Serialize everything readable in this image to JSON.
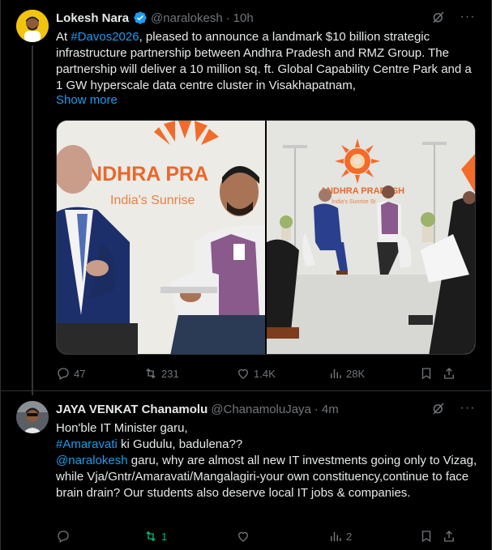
{
  "tweet1": {
    "author_name": "Lokesh Nara",
    "handle": "@naralokesh",
    "separator": "·",
    "time": "10h",
    "text_parts": {
      "pre": "At ",
      "hashtag": "#Davos2026",
      "post": ", pleased to announce a landmark $10 billion strategic infrastructure partnership between Andhra Pradesh and RMZ Group. The partnership will deliver a 10 million sq. ft. Global Capability Centre Park and a 1 GW hyperscale data centre cluster in Visakhapatnam,"
    },
    "show_more": "Show more",
    "media": {
      "left_banner_title": "ANDHRA PRA",
      "left_banner_sub": "India's Sunrise",
      "right_banner_title": "ANDHRA PRADESH",
      "right_banner_sub": "India's Sunrise St"
    },
    "actions": {
      "replies": "47",
      "reposts": "231",
      "likes": "1.4K",
      "views": "28K"
    }
  },
  "tweet2": {
    "author_name": "JAYA VENKAT Chanamolu",
    "handle": "@ChanamoluJaya",
    "separator": "·",
    "time": "4m",
    "line1": "Hon'ble IT Minister garu,",
    "line2_hashtag": "#Amaravati",
    "line2_rest": " ki Gudulu, badulena??",
    "mention": "@naralokesh",
    "line3_rest": " garu, why are almost all new IT investments going only to Vizag, while Vja/Gntr/Amaravati/Mangalagiri-your own constituency,continue to face brain drain? Our students also deserve local IT jobs & companies.",
    "actions": {
      "replies": "",
      "reposts": "1",
      "likes": "",
      "views": "2"
    }
  },
  "colors": {
    "background": "#000000",
    "text": "#e7e9ea",
    "muted": "#71767b",
    "accent": "#1d9bf0",
    "repost_active": "#00ba7c",
    "border": "#2f3336"
  },
  "icons": [
    "verified-badge-icon",
    "grok-icon",
    "more-icon",
    "reply-icon",
    "repost-icon",
    "like-icon",
    "views-icon",
    "bookmark-icon",
    "share-icon"
  ]
}
